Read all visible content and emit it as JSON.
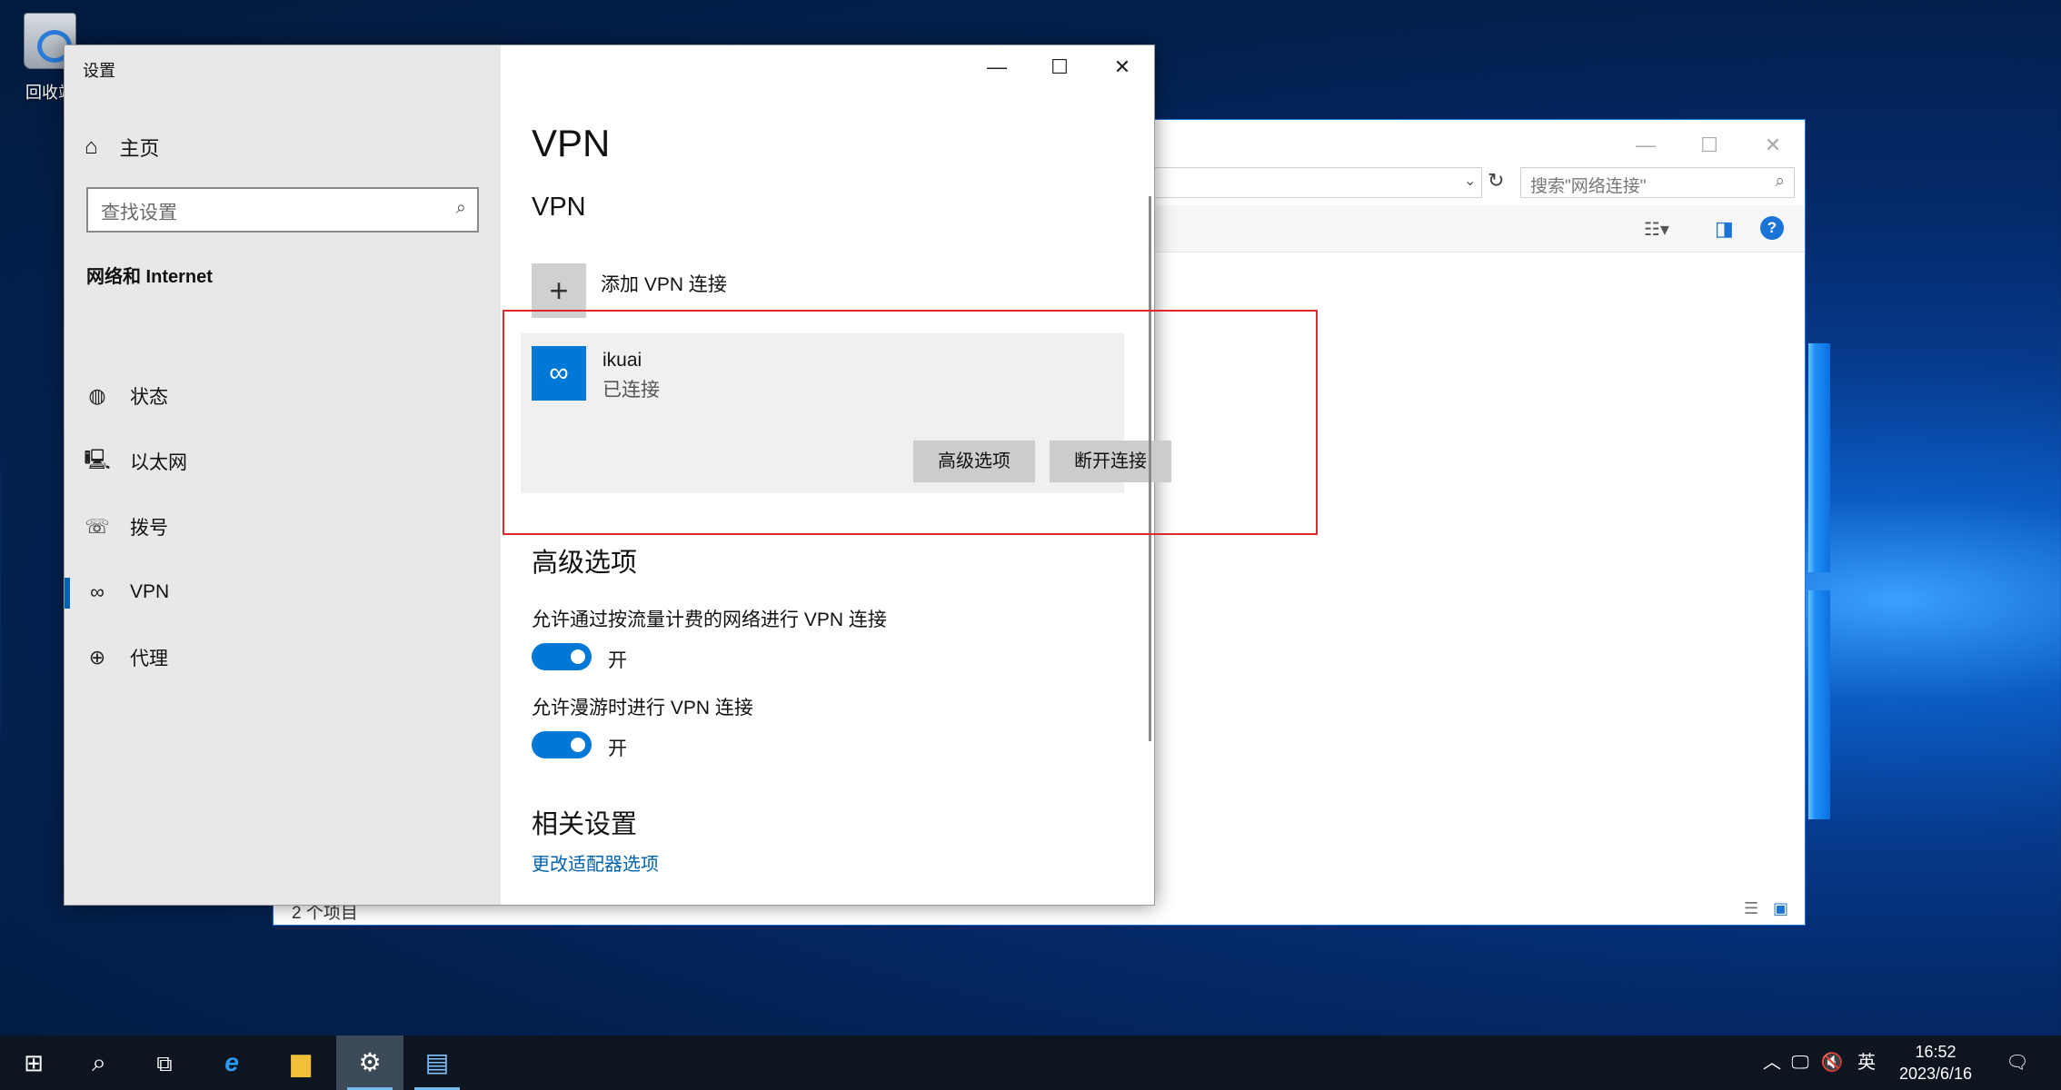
{
  "desktop": {
    "recycle_bin_label": "回收站"
  },
  "explorer": {
    "search_placeholder": "搜索\"网络连接\"",
    "status_count": "2 个项目",
    "minimize": "—",
    "maximize": "☐",
    "close": "✕"
  },
  "settings": {
    "window_title": "设置",
    "minimize": "—",
    "maximize": "☐",
    "close": "✕",
    "sidebar": {
      "home_label": "主页",
      "search_placeholder": "查找设置",
      "category": "网络和 Internet",
      "items": [
        {
          "label": "状态",
          "icon": "globe-status-icon"
        },
        {
          "label": "以太网",
          "icon": "ethernet-icon"
        },
        {
          "label": "拨号",
          "icon": "dialup-icon"
        },
        {
          "label": "VPN",
          "icon": "vpn-icon",
          "active": true
        },
        {
          "label": "代理",
          "icon": "globe-icon"
        }
      ]
    },
    "main": {
      "page_title": "VPN",
      "section_vpn": "VPN",
      "add_vpn_label": "添加 VPN 连接",
      "connection": {
        "name": "ikuai",
        "status": "已连接"
      },
      "advanced_button": "高级选项",
      "disconnect_button": "断开连接",
      "advanced_heading": "高级选项",
      "metered_label": "允许通过按流量计费的网络进行 VPN 连接",
      "metered_state": "开",
      "roaming_label": "允许漫游时进行 VPN 连接",
      "roaming_state": "开",
      "related_heading": "相关设置",
      "adapter_link": "更改适配器选项"
    }
  },
  "taskbar": {
    "ime": "英",
    "time": "16:52",
    "date": "2023/6/16"
  },
  "colors": {
    "accent": "#0078d7",
    "highlight_box": "#e2262a"
  }
}
